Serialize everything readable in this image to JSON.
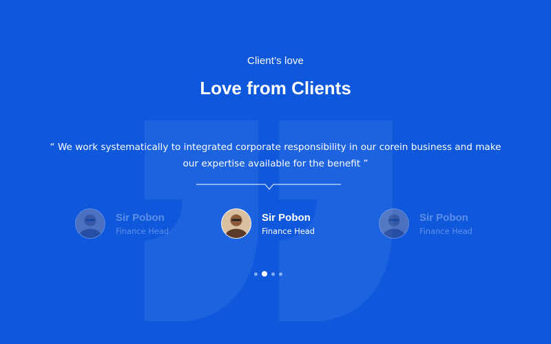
{
  "section": {
    "subtitle": "Client’s love",
    "title": "Love from Clients"
  },
  "testimonial": {
    "quote_line1": "“ We work systematically to integrated corporate responsibility in our corein business and make",
    "quote_line2": "our expertise available for the benefit ”"
  },
  "clients": [
    {
      "name": "Sir Pobon",
      "role": "Finance Head",
      "state": "faded"
    },
    {
      "name": "Sir Pobon",
      "role": "Finance Head",
      "state": "active"
    },
    {
      "name": "Sir Pobon",
      "role": "Finance Head",
      "state": "faded"
    }
  ],
  "pagination": {
    "count": 4,
    "active_index": 1
  },
  "colors": {
    "background": "#0f58dc",
    "text": "#ffffff",
    "quote_mark": "#2a6ee4"
  }
}
